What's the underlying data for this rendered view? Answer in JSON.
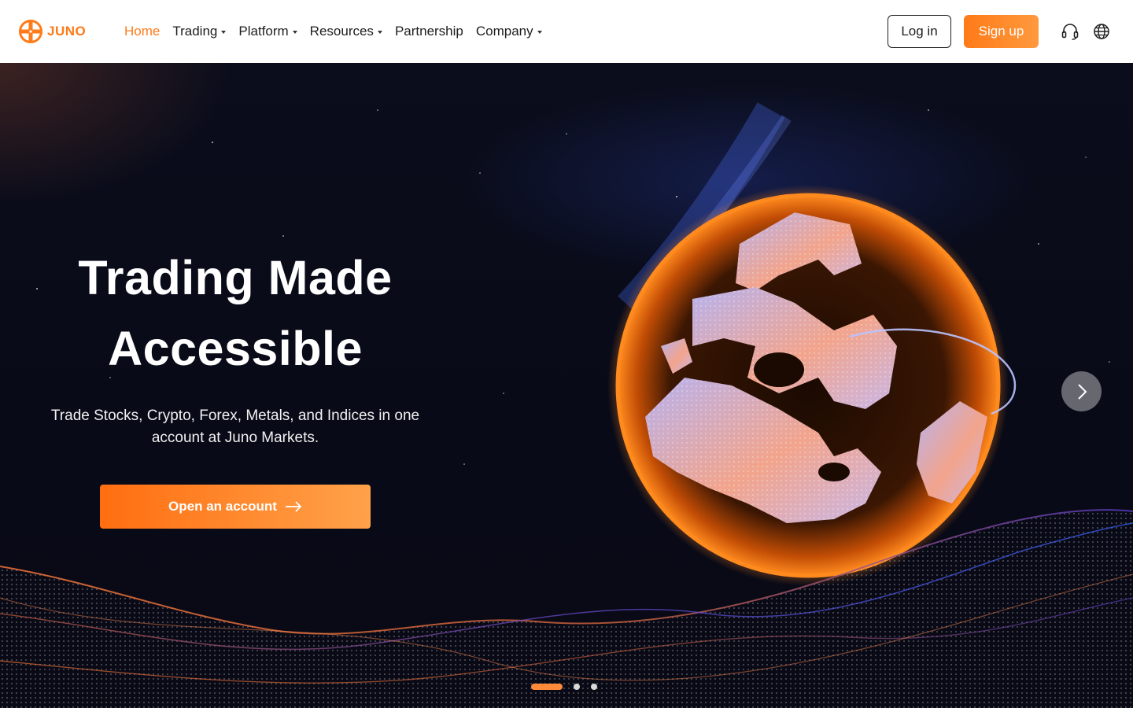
{
  "brand": {
    "name": "JUNO",
    "accent": "#ff7a18"
  },
  "nav": {
    "items": [
      {
        "label": "Home",
        "active": true,
        "dropdown": false
      },
      {
        "label": "Trading",
        "active": false,
        "dropdown": true
      },
      {
        "label": "Platform",
        "active": false,
        "dropdown": true
      },
      {
        "label": "Resources",
        "active": false,
        "dropdown": true
      },
      {
        "label": "Partnership",
        "active": false,
        "dropdown": false
      },
      {
        "label": "Company",
        "active": false,
        "dropdown": true
      }
    ]
  },
  "header": {
    "login_label": "Log in",
    "signup_label": "Sign up",
    "support_icon": "headset-icon",
    "language_icon": "globe-icon"
  },
  "hero": {
    "title_line1": "Trading Made",
    "title_line2": "Accessible",
    "subtitle": "Trade Stocks, Crypto, Forex, Metals, and Indices in one account at Juno Markets.",
    "cta_label": "Open an account",
    "cta_icon": "arrow-right-icon",
    "next_icon": "chevron-right-icon"
  },
  "carousel": {
    "slide_count": 3,
    "active_index": 0
  }
}
